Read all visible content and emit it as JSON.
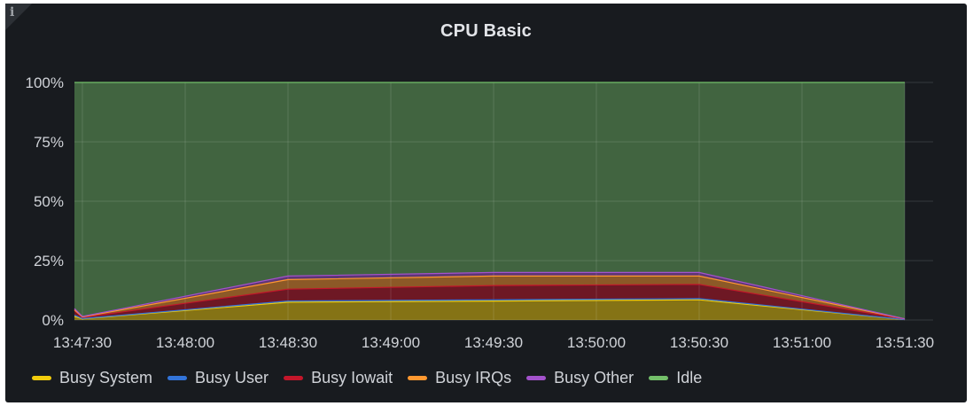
{
  "panel": {
    "title": "CPU Basic",
    "info_icon": "info-icon"
  },
  "chart_data": {
    "type": "area",
    "stacked": true,
    "title": "CPU Basic",
    "x": [
      "13:47:20",
      "13:47:30",
      "13:48:30",
      "13:49:30",
      "13:50:30",
      "13:51:30"
    ],
    "xticks": [
      "13:47:30",
      "13:48:00",
      "13:48:30",
      "13:49:00",
      "13:49:30",
      "13:50:00",
      "13:50:30",
      "13:51:00",
      "13:51:30"
    ],
    "yticks": [
      "0%",
      "25%",
      "50%",
      "75%",
      "100%"
    ],
    "ylim": [
      0,
      100
    ],
    "grid": true,
    "legend_position": "bottom",
    "series": [
      {
        "name": "Busy System",
        "color": "#f2cc0c",
        "values": [
          1.5,
          0.5,
          7.5,
          8.0,
          8.5,
          0.2
        ]
      },
      {
        "name": "Busy User",
        "color": "#3274d9",
        "values": [
          0.5,
          0.1,
          0.5,
          0.5,
          0.5,
          0.0
        ]
      },
      {
        "name": "Busy Iowait",
        "color": "#c4162a",
        "values": [
          2.0,
          0.5,
          5.0,
          6.0,
          6.0,
          0.2
        ]
      },
      {
        "name": "Busy IRQs",
        "color": "#ff9830",
        "values": [
          0.3,
          0.2,
          4.0,
          4.0,
          3.5,
          0.1
        ]
      },
      {
        "name": "Busy Other",
        "color": "#a352cc",
        "values": [
          0.5,
          0.2,
          1.5,
          1.5,
          1.5,
          0.0
        ]
      },
      {
        "name": "Idle",
        "color": "#73bf69",
        "values": [
          95.2,
          98.5,
          81.5,
          80.0,
          80.0,
          99.5
        ]
      }
    ]
  }
}
